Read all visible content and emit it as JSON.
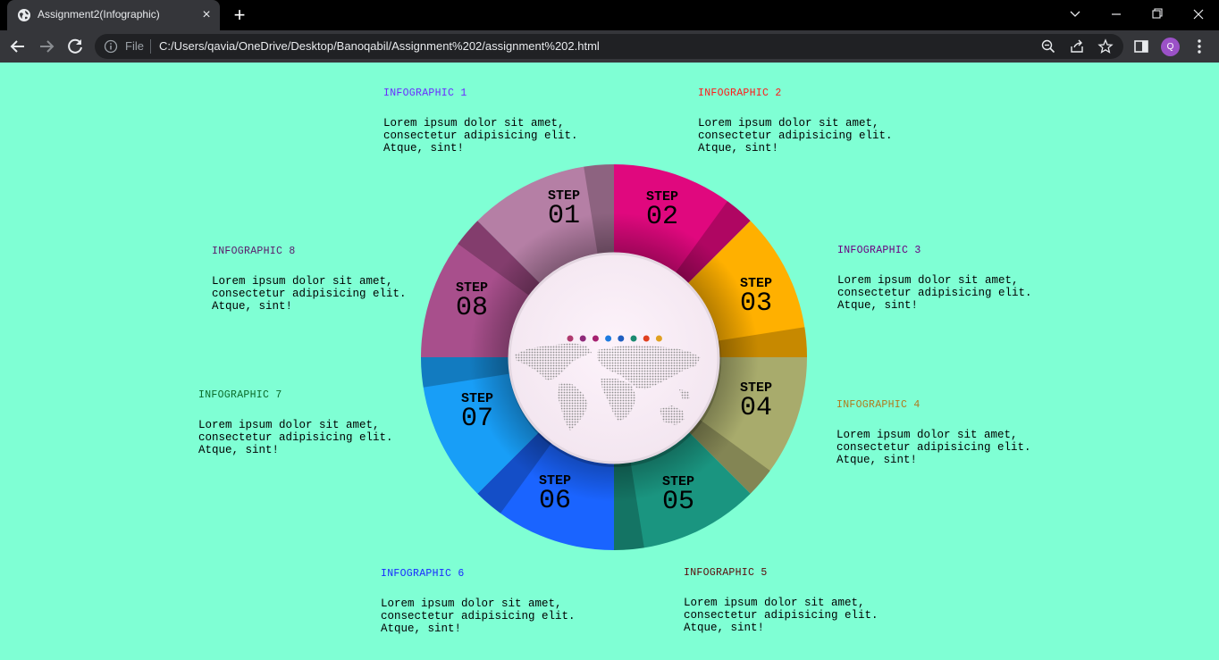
{
  "browser": {
    "tab_title": "Assignment2(Infographic)",
    "new_tab_label": "+",
    "close_label": "×",
    "file_label": "File",
    "url": "C:/Users/qavia/OneDrive/Desktop/Banoqabil/Assignment%202/assignment%202.html",
    "avatar_initial": "Q"
  },
  "infographics": [
    {
      "title": "INFOGRAPHIC 1",
      "color": "#6a2cff",
      "text": "Lorem ipsum dolor sit amet, consectetur adipisicing elit. Atque, sint!"
    },
    {
      "title": "INFOGRAPHIC 2",
      "color": "#ff1a1a",
      "text": "Lorem ipsum dolor sit amet, consectetur adipisicing elit. Atque, sint!"
    },
    {
      "title": "INFOGRAPHIC 3",
      "color": "#6a0080",
      "text": "Lorem ipsum dolor sit amet, consectetur adipisicing elit. Atque, sint!"
    },
    {
      "title": "INFOGRAPHIC 4",
      "color": "#b07a1e",
      "text": "Lorem ipsum dolor sit amet, consectetur adipisicing elit. Atque, sint!"
    },
    {
      "title": "INFOGRAPHIC 5",
      "color": "#5a0a0a",
      "text": "Lorem ipsum dolor sit amet, consectetur adipisicing elit. Atque, sint!"
    },
    {
      "title": "INFOGRAPHIC 6",
      "color": "#1a2bff",
      "text": "Lorem ipsum dolor sit amet, consectetur adipisicing elit. Atque, sint!"
    },
    {
      "title": "INFOGRAPHIC 7",
      "color": "#0a6a2a",
      "text": "Lorem ipsum dolor sit amet, consectetur adipisicing elit. Atque, sint!"
    },
    {
      "title": "INFOGRAPHIC 8",
      "color": "#5a1a6a",
      "text": "Lorem ipsum dolor sit amet, consectetur adipisicing elit. Atque, sint!"
    }
  ],
  "steps": [
    {
      "word": "STEP",
      "num": "01",
      "color": "#b57fa5"
    },
    {
      "word": "STEP",
      "num": "02",
      "color": "#e0087e"
    },
    {
      "word": "STEP",
      "num": "03",
      "color": "#ffb000"
    },
    {
      "word": "STEP",
      "num": "04",
      "color": "#a8ab6c"
    },
    {
      "word": "STEP",
      "num": "05",
      "color": "#1a9580"
    },
    {
      "word": "STEP",
      "num": "06",
      "color": "#1a64ff"
    },
    {
      "word": "STEP",
      "num": "07",
      "color": "#189ef7"
    },
    {
      "word": "STEP",
      "num": "08",
      "color": "#a84f8c"
    }
  ],
  "center_dot_colors": [
    "#b03a6e",
    "#8e2a7a",
    "#a62070",
    "#1e7be0",
    "#1f5ec0",
    "#1a8a70",
    "#e04020",
    "#e0a020"
  ],
  "page_background": "#7fffd4"
}
